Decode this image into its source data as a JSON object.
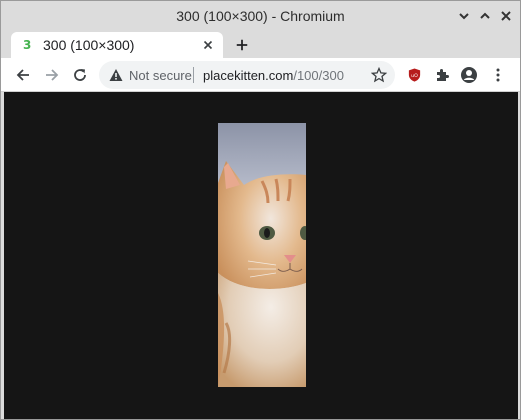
{
  "window": {
    "title": "300 (100×300) - Chromium",
    "controls": [
      "chevron-down",
      "chevron-up",
      "close"
    ]
  },
  "tab": {
    "favicon_glyph": "3",
    "title": "300 (100×300)"
  },
  "toolbar": {
    "security_label": "Not secure",
    "url_host": "placekitten.com",
    "url_path": "/100/300"
  },
  "content": {
    "image_alt": "kitten",
    "background": "#151515"
  },
  "colors": {
    "frame": "#dcdcdc",
    "tab": "#ffffff",
    "omnibox": "#f1f3f4",
    "ublock": "#b71c1c"
  }
}
